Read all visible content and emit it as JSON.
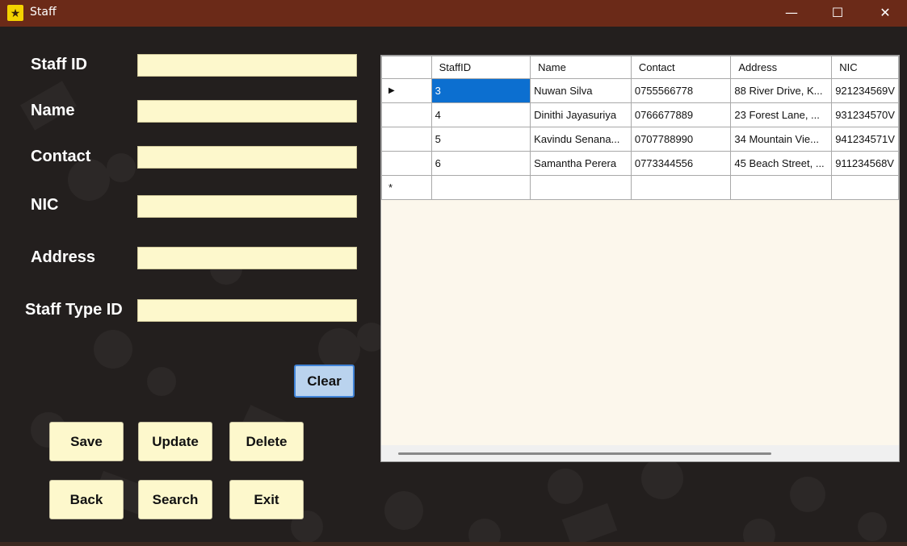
{
  "window": {
    "title": "Staff",
    "icon": "film-reel-star-icon",
    "controls": {
      "minimize": "—",
      "maximize": "☐",
      "close": "✕"
    }
  },
  "form": {
    "staff_id_label": "Staff ID",
    "name_label": "Name",
    "contact_label": "Contact",
    "nic_label": "NIC",
    "address_label": "Address",
    "staff_type_id_label": "Staff Type ID",
    "staff_id_value": "",
    "name_value": "",
    "contact_value": "",
    "nic_value": "",
    "address_value": "",
    "staff_type_id_value": ""
  },
  "buttons": {
    "clear": "Clear",
    "save": "Save",
    "update": "Update",
    "delete": "Delete",
    "back": "Back",
    "search": "Search",
    "exit": "Exit"
  },
  "grid": {
    "columns": [
      "StaffID",
      "Name",
      "Contact",
      "Address",
      "NIC"
    ],
    "rows": [
      {
        "staff_id": "3",
        "name": "Nuwan Silva",
        "contact": "0755566778",
        "address": "88 River Drive, K...",
        "nic": "921234569V",
        "current": true
      },
      {
        "staff_id": "4",
        "name": "Dinithi Jayasuriya",
        "contact": "0766677889",
        "address": "23 Forest Lane, ...",
        "nic": "931234570V",
        "current": false
      },
      {
        "staff_id": "5",
        "name": "Kavindu Senana...",
        "contact": "0707788990",
        "address": "34 Mountain Vie...",
        "nic": "941234571V",
        "current": false
      },
      {
        "staff_id": "6",
        "name": "Samantha Perera",
        "contact": "0773344556",
        "address": "45 Beach Street, ...",
        "nic": "911234568V",
        "current": false
      }
    ],
    "current_row_marker": "▶",
    "new_row_marker": "*"
  },
  "colors": {
    "titlebar": "#6b2a18",
    "background": "#231f1e",
    "input_bg": "#fdf8cc",
    "button_bg": "#fdf8cc",
    "selected_cell": "#0c6fd0",
    "clear_button_bg": "#bad3ee"
  }
}
